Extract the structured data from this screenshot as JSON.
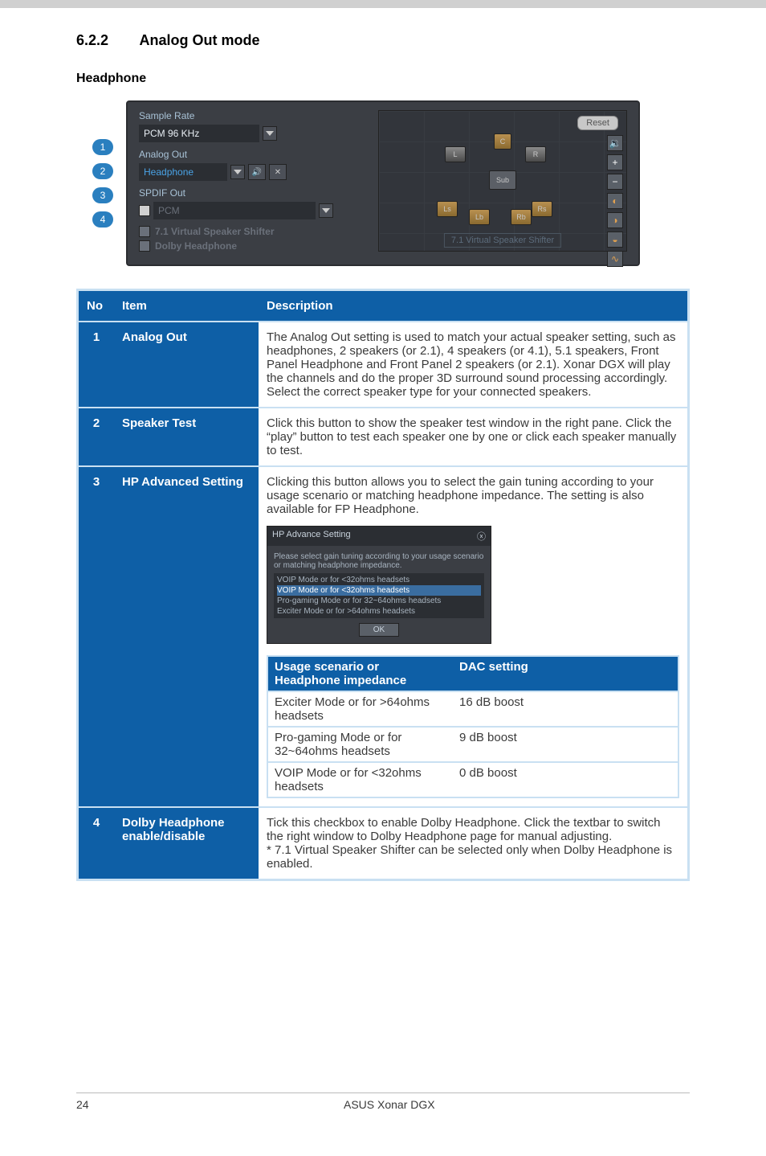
{
  "section": {
    "number": "6.2.2",
    "title": "Analog Out mode"
  },
  "subheading": "Headphone",
  "callouts": [
    "1",
    "2",
    "3",
    "4"
  ],
  "panel": {
    "sample_rate_label": "Sample Rate",
    "sample_rate_value": "PCM 96 KHz",
    "analog_out_label": "Analog Out",
    "analog_out_value": "Headphone",
    "spdif_out_label": "SPDIF Out",
    "spdif_out_value": "PCM",
    "virtual_speaker_label": "7.1 Virtual Speaker Shifter",
    "dolby_hp_label": "Dolby Headphone",
    "reset_button": "Reset",
    "side_icons": [
      "vol-icon",
      "plus-icon",
      "minus-icon",
      "mixer-icon",
      "effect-icon",
      "eq-icon",
      "flex-icon"
    ],
    "vss_caption": "7.1 Virtual Speaker Shifter",
    "speakers": {
      "c": "C",
      "l": "L",
      "r": "R",
      "sub": "Sub",
      "ls": "Ls",
      "rs": "Rs",
      "lb": "Lb",
      "rb": "Rb"
    }
  },
  "table_headers": {
    "no": "No",
    "item": "Item",
    "description": "Description"
  },
  "rows": [
    {
      "no": "1",
      "item": "Analog Out",
      "desc": "The Analog Out setting is used to match your actual speaker setting, such as headphones, 2 speakers (or 2.1), 4 speakers (or 4.1), 5.1 speakers, Front Panel Headphone and Front Panel 2 speakers (or 2.1). Xonar DGX will play the channels and do the proper 3D surround sound processing accordingly. Select the correct speaker type for your connected speakers."
    },
    {
      "no": "2",
      "item": "Speaker Test",
      "desc": "Click this button to show the speaker test window in the right pane. Click the “play” button to test each speaker one by one or click each speaker manually to test."
    },
    {
      "no": "3",
      "item": "HP Advanced Setting",
      "desc_intro": "Clicking this button allows you to select the gain tuning according to your usage scenario or matching headphone impedance. The setting is also available for FP Headphone.",
      "dialog": {
        "title": "HP Advance Setting",
        "prompt": "Please select gain tuning according to your usage scenario or matching headphone impedance.",
        "options": [
          "VOIP Mode or for <32ohms headsets",
          "VOIP Mode or for <32ohms headsets",
          "Pro-gaming Mode or for 32~64ohms headsets",
          "Exciter Mode or for >64ohms headsets"
        ],
        "ok": "OK"
      },
      "inner_table": {
        "h1": "Usage scenario or Headphone impedance",
        "h2": "DAC setting",
        "rows": [
          {
            "a": "Exciter Mode or for >64ohms headsets",
            "b": "16 dB boost"
          },
          {
            "a": "Pro-gaming Mode or for 32~64ohms headsets",
            "b": "9 dB boost"
          },
          {
            "a": "VOIP Mode or for <32ohms headsets",
            "b": "0 dB boost"
          }
        ]
      }
    },
    {
      "no": "4",
      "item": "Dolby Headphone enable/disable",
      "desc": "Tick this checkbox to enable Dolby Headphone. Click the textbar to switch the right window to Dolby Headphone page for manual adjusting.\n* 7.1 Virtual Speaker Shifter can be selected only when Dolby Headphone is enabled."
    }
  ],
  "footer": {
    "page": "24",
    "product": "ASUS Xonar DGX"
  }
}
